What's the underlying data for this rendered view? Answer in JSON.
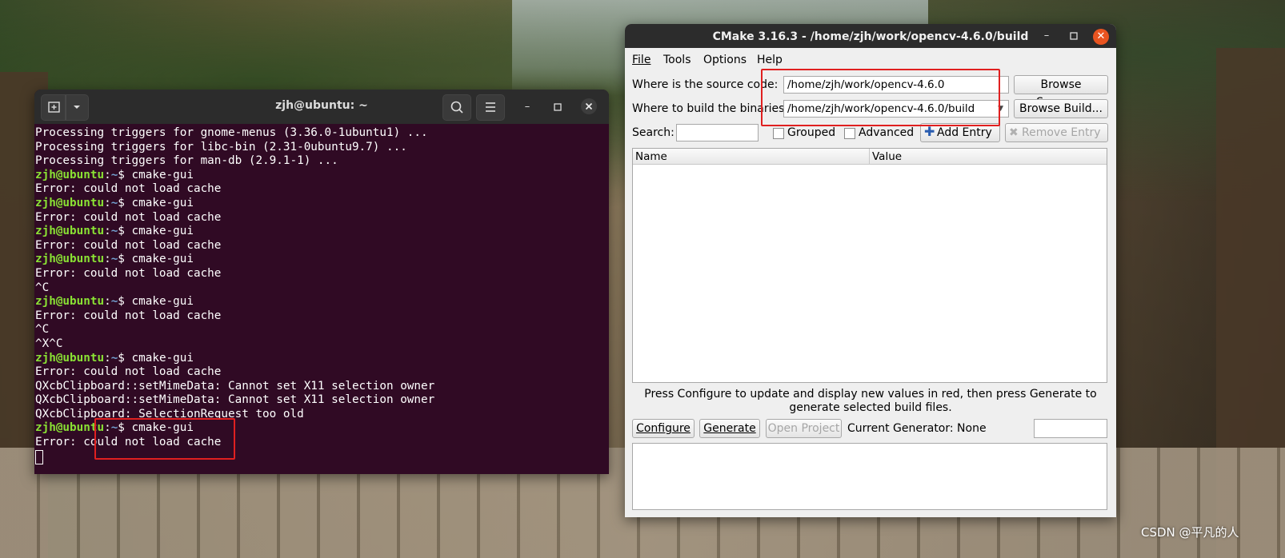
{
  "terminal": {
    "title": "zjh@ubuntu: ~",
    "user_host": "zjh@ubuntu",
    "path": "~",
    "lines": [
      {
        "kind": "out",
        "text": "Processing triggers for gnome-menus (3.36.0-1ubuntu1) ..."
      },
      {
        "kind": "out",
        "text": "Processing triggers for libc-bin (2.31-0ubuntu9.7) ..."
      },
      {
        "kind": "out",
        "text": "Processing triggers for man-db (2.9.1-1) ..."
      },
      {
        "kind": "cmd",
        "text": "cmake-gui"
      },
      {
        "kind": "out",
        "text": "Error: could not load cache"
      },
      {
        "kind": "cmd",
        "text": "cmake-gui"
      },
      {
        "kind": "out",
        "text": "Error: could not load cache"
      },
      {
        "kind": "cmd",
        "text": "cmake-gui"
      },
      {
        "kind": "out",
        "text": "Error: could not load cache"
      },
      {
        "kind": "cmd",
        "text": "cmake-gui"
      },
      {
        "kind": "out",
        "text": "Error: could not load cache"
      },
      {
        "kind": "out",
        "text": "^C"
      },
      {
        "kind": "cmd",
        "text": "cmake-gui"
      },
      {
        "kind": "out",
        "text": "Error: could not load cache"
      },
      {
        "kind": "out",
        "text": "^C"
      },
      {
        "kind": "out",
        "text": "^X^C"
      },
      {
        "kind": "cmd",
        "text": "cmake-gui"
      },
      {
        "kind": "out",
        "text": "Error: could not load cache"
      },
      {
        "kind": "out",
        "text": "QXcbClipboard::setMimeData: Cannot set X11 selection owner"
      },
      {
        "kind": "out",
        "text": "QXcbClipboard::setMimeData: Cannot set X11 selection owner"
      },
      {
        "kind": "out",
        "text": "QXcbClipboard: SelectionRequest too old"
      },
      {
        "kind": "cmd",
        "text": "cmake-gui"
      },
      {
        "kind": "out",
        "text": "Error: could not load cache"
      },
      {
        "kind": "cursor",
        "text": ""
      }
    ],
    "icons": {
      "new_tab": "new-tab-icon",
      "menu_chevron": "chevron-down-icon",
      "search": "search-icon",
      "hamburger": "hamburger-icon",
      "minimize": "minimize-icon",
      "maximize": "maximize-icon",
      "close": "close-icon"
    }
  },
  "cmake": {
    "title": "CMake 3.16.3 - /home/zjh/work/opencv-4.6.0/build",
    "menu": [
      "File",
      "Tools",
      "Options",
      "Help"
    ],
    "source_label": "Where is the source code:",
    "source_value": "/home/zjh/work/opencv-4.6.0",
    "build_label": "Where to build the binaries:",
    "build_value": "/home/zjh/work/opencv-4.6.0/build",
    "browse_source": "Browse Source...",
    "browse_build": "Browse Build...",
    "search_label": "Search:",
    "grouped_label": "Grouped",
    "advanced_label": "Advanced",
    "add_entry": "Add Entry",
    "remove_entry": "Remove Entry",
    "columns": [
      "Name",
      "Value"
    ],
    "info_text": "Press Configure to update and display new values in red, then press Generate to generate selected build files.",
    "configure": "Configure",
    "generate": "Generate",
    "open_project": "Open Project",
    "current_generator": "Current Generator: None"
  },
  "watermark": "CSDN @平凡的人",
  "colors": {
    "terminal_bg": "#300a24",
    "prompt_user": "#8ae234",
    "prompt_path": "#729fcf",
    "highlight": "#e02020",
    "ubuntu_orange": "#e95420"
  }
}
